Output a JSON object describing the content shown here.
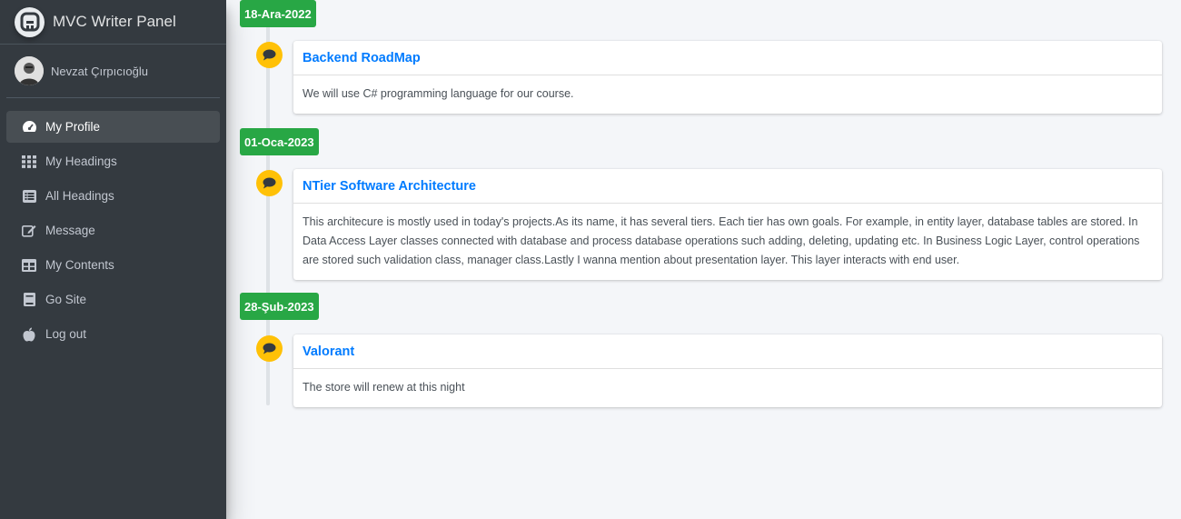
{
  "brand": {
    "title": "MVC Writer Panel",
    "logo_icon": "brand-logo-icon"
  },
  "user": {
    "name": "Nevzat Çırpıcıoğlu"
  },
  "nav": [
    {
      "label": "My Profile",
      "icon": "tachometer-icon",
      "active": true
    },
    {
      "label": "My Headings",
      "icon": "grid-icon"
    },
    {
      "label": "All Headings",
      "icon": "list-icon"
    },
    {
      "label": "Message",
      "icon": "edit-icon"
    },
    {
      "label": "My Contents",
      "icon": "table-icon"
    },
    {
      "label": "Go Site",
      "icon": "book-icon"
    },
    {
      "label": "Log out",
      "icon": "apple-icon"
    }
  ],
  "timeline": [
    {
      "date": "18-Ara-2022",
      "title": "Backend RoadMap",
      "body": "We will use C# programming language for our course."
    },
    {
      "date": "01-Oca-2023",
      "title": "NTier Software Architecture",
      "body": "This architecure is mostly used in today's projects.As its name, it has several tiers. Each tier has own goals. For example, in entity layer, database tables are stored. In Data Access Layer classes connected with database and process database operations such adding, deleting, updating etc. In Business Logic Layer, control operations are stored such validation class, manager class.Lastly I wanna mention about presentation layer. This layer interacts with end user."
    },
    {
      "date": "28-Şub-2023",
      "title": "Valorant",
      "body": "The store will renew at this night"
    }
  ],
  "colors": {
    "sidebar_bg": "#343a40",
    "date_badge": "#28a745",
    "timeline_icon": "#ffc107",
    "link": "#007bff"
  }
}
